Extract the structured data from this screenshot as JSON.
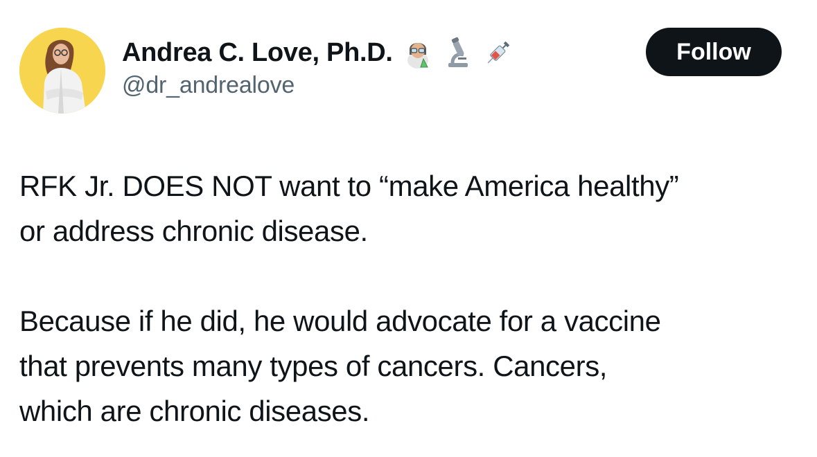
{
  "author": {
    "display_name": "Andrea C. Love, Ph.D.",
    "handle": "@dr_andrealove",
    "name_emojis": [
      "scientist-emoji",
      "microscope-emoji",
      "syringe-emoji"
    ],
    "avatar_bg": "#f7d54f"
  },
  "follow_button": {
    "label": "Follow",
    "bg": "#0f1419",
    "color": "#ffffff"
  },
  "tweet": {
    "paragraphs": [
      {
        "lines": [
          "RFK Jr. DOES NOT want to “make America healthy”",
          "or address chronic disease."
        ]
      },
      {
        "lines": [
          "Because if he did, he would advocate for a vaccine",
          "that prevents many types of cancers. Cancers,",
          "which are chronic diseases."
        ]
      }
    ]
  }
}
